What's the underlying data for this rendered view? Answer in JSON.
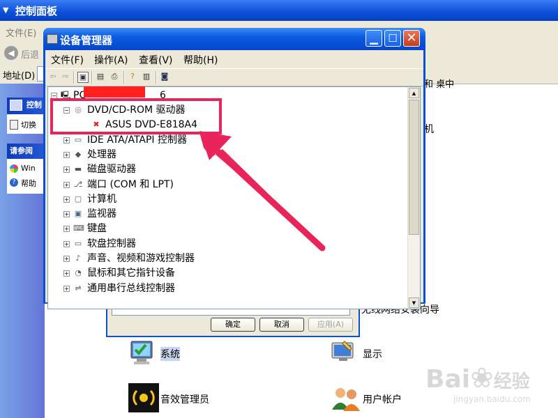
{
  "control_panel": {
    "title": "控制面板",
    "menu_file": "文件(E)",
    "back_label": "后退",
    "address_label": "地址(D)",
    "taskpane": {
      "panel1_title": "控制",
      "panel1_item": "切换",
      "panel2_title": "请参阅",
      "panel2_items": [
        "Win",
        "帮助"
      ]
    },
    "right_items": [
      "机"
    ],
    "right_partial_top": "和  桌中",
    "wizard_label": "无线网络安装向导",
    "items": [
      {
        "label": "系统",
        "icon": "system-icon"
      },
      {
        "label": "显示",
        "icon": "display-icon"
      },
      {
        "label": "音效管理员",
        "icon": "sound-manager-icon"
      },
      {
        "label": "用户帐户",
        "icon": "users-icon"
      }
    ]
  },
  "system_dialog": {
    "ok": "确定",
    "cancel": "取消",
    "apply": "应用(A)"
  },
  "device_manager": {
    "title": "设备管理器",
    "menus": [
      "文件(F)",
      "操作(A)",
      "查看(V)",
      "帮助(H)"
    ],
    "tree": {
      "root": "PC",
      "root_suffix": "6",
      "nodes": [
        {
          "label": "DVD/CD-ROM 驱动器",
          "expanded": true,
          "icon": "cdrom-icon"
        },
        {
          "label": "ASUS DVD-E818A4",
          "child": true,
          "icon": "device-error-icon"
        },
        {
          "label": "IDE ATA/ATAPI 控制器",
          "icon": "ide-icon"
        },
        {
          "label": "处理器",
          "icon": "processor-icon"
        },
        {
          "label": "磁盘驱动器",
          "icon": "disk-icon"
        },
        {
          "label": "端口 (COM 和 LPT)",
          "icon": "port-icon"
        },
        {
          "label": "计算机",
          "icon": "computer-icon"
        },
        {
          "label": "监视器",
          "icon": "monitor-icon"
        },
        {
          "label": "键盘",
          "icon": "keyboard-icon"
        },
        {
          "label": "软盘控制器",
          "icon": "floppy-icon"
        },
        {
          "label": "声音、视频和游戏控制器",
          "icon": "sound-icon"
        },
        {
          "label": "鼠标和其它指针设备",
          "icon": "mouse-icon"
        },
        {
          "label": "通用串行总线控制器",
          "icon": "usb-icon"
        }
      ]
    }
  },
  "watermark": {
    "brand": "Bai",
    "brand2": "经验",
    "url": "jingyan.baidu.com"
  },
  "colors": {
    "highlight": "#e8245a",
    "xp_blue": "#0a4fd9"
  }
}
